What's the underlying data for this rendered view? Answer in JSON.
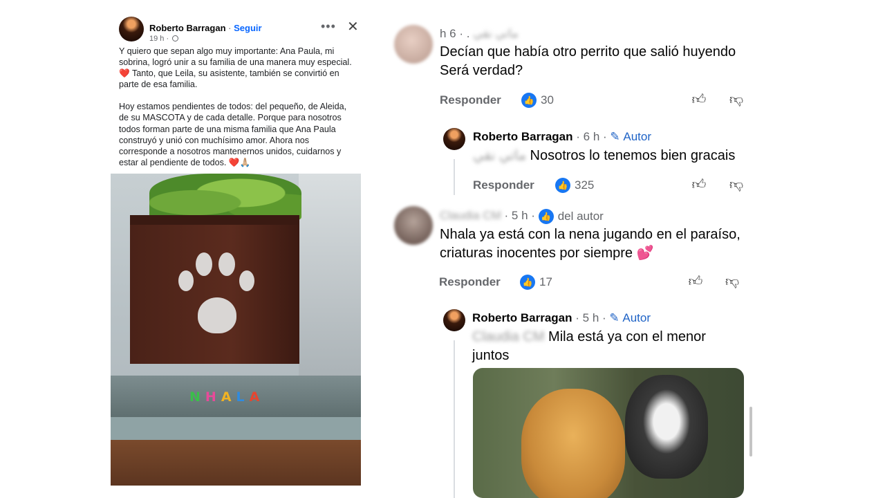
{
  "post": {
    "author": "Roberto Barragan",
    "follow": "Seguir",
    "time": "19 h ·",
    "paragraph1": "Y quiero que sepan algo muy importante: Ana Paula, mi sobrina, logró unir a su familia de una manera muy especial. ❤️ Tanto, que Leila, su asistente, también se convirtió en parte de esa familia.",
    "paragraph2": "Hoy estamos pendientes de todos: del pequeño, de Aleida, de su MASCOTA  y de cada detalle. Porque para nosotros todos forman parte de una misma familia que Ana Paula construyó y unió con muchísimo amor. Ahora nos corresponde a nosotros mantenernos unidos, cuidarnos y estar al pendiente de todos. ❤️🙏🏼",
    "box_label": [
      "N",
      "H",
      "A",
      "L",
      "A"
    ],
    "box_label_colors": [
      "#3bbf4a",
      "#e84a9a",
      "#f0b323",
      "#2f8be0",
      "#e8452f"
    ]
  },
  "comments": [
    {
      "meta_time": "h 6 · .",
      "meta_name_blurred": "ماتي نقي",
      "text": "Decían que había otro perrito que salió huyendo Será verdad?",
      "reply": "Responder",
      "likes": "30"
    },
    {
      "author": "Roberto Barragan",
      "time": "· 6 h ·",
      "author_tag": "Autor",
      "mention_blurred": "ماتي نقي",
      "text": "Nosotros lo tenemos bien gracais",
      "reply": "Responder",
      "likes": "325"
    },
    {
      "name_blurred": "Claudia CM",
      "time": "· 5 h ·",
      "badge": "del autor",
      "text": "Nhala ya está con la nena jugando en el paraíso, criaturas inocentes por siempre 💕",
      "reply": "Responder",
      "likes": "17"
    },
    {
      "author": "Roberto Barragan",
      "time": "· 5 h ·",
      "author_tag": "Autor",
      "mention_blurred": "Claudia CM",
      "text": "Mila está ya con el menor juntos"
    }
  ],
  "colors": {
    "accent": "#1877f2",
    "link": "#0866ff",
    "author_tag": "#1f63c6",
    "muted": "#65676b"
  },
  "icons": [
    "globe-icon",
    "more-icon",
    "close-icon",
    "like-badge-icon",
    "thumbs-up-icon",
    "thumbs-down-icon",
    "pencil-icon"
  ]
}
